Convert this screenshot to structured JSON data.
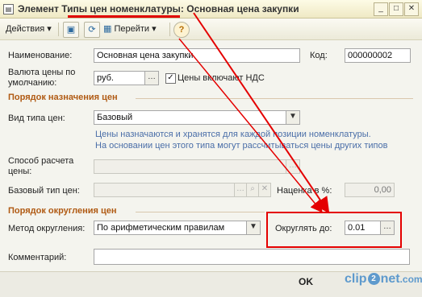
{
  "title_bar": {
    "prefix": "Элемент",
    "catalog": "Типы цен номенклатуры",
    "separator": ":",
    "name": "Основная цена закупки",
    "minimize": "_",
    "maximize": "□",
    "close": "✕"
  },
  "toolbar": {
    "actions_label": "Действия",
    "goto_label": "Перейти",
    "help_icon": "?"
  },
  "form": {
    "name_label": "Наименование:",
    "name_value": "Основная цена закупки",
    "code_label": "Код:",
    "code_value": "000000002",
    "currency_label_line1": "Валюта цены по",
    "currency_label_line2": "умолчанию:",
    "currency_value": "руб.",
    "vat_checkbox_label": "Цены включают НДС",
    "vat_checked": true
  },
  "section_assignment": {
    "title": "Порядок назначения цен",
    "price_type_kind_label": "Вид типа цен:",
    "price_type_kind_value": "Базовый",
    "info_line1": "Цены назначаются и хранятся для каждой позиции номенклатуры.",
    "info_line2": "На основании цен этого типа могут рассчитываться цены других типов",
    "calc_method_label_line1": "Способ расчета",
    "calc_method_label_line2": "цены:",
    "calc_method_value": "",
    "base_type_label": "Базовый тип цен:",
    "base_type_value": "",
    "markup_label": "Наценка в %:",
    "markup_value": "0,00"
  },
  "section_rounding": {
    "title": "Порядок округления цен",
    "method_label": "Метод округления:",
    "method_value": "По арифметическим правилам",
    "round_to_label": "Округлять до:",
    "round_to_value": "0.01"
  },
  "comment": {
    "label": "Комментарий:",
    "value": ""
  },
  "footer": {
    "ok_label": "OK",
    "watermark_part1": "clip",
    "watermark_badge": "2",
    "watermark_part2": "net",
    "watermark_part3": ".com"
  },
  "colors": {
    "annotation_red": "#e40000",
    "section_title": "#b05a13",
    "info_text": "#4a6ea8"
  }
}
